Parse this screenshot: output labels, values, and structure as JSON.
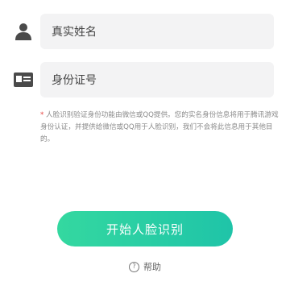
{
  "form": {
    "name_field": {
      "placeholder": "真实姓名",
      "icon": "user-icon"
    },
    "id_field": {
      "placeholder": "身份证号",
      "icon": "id-card-icon"
    }
  },
  "notice": {
    "marker": "*",
    "text": "人脸识别验证身份功能由微信或QQ提供。您的实名身份信息将用于腾讯游戏身份认证，并提供给微信或QQ用于人脸识别，我们不会将此信息用于其他目的。"
  },
  "actions": {
    "start_label": "开始人脸识别",
    "help_label": "帮助",
    "help_icon": "question-circle-icon"
  },
  "colors": {
    "button_gradient_start": "#34d8a0",
    "button_gradient_end": "#1fc4a8",
    "notice_marker": "#e64340",
    "field_background": "#f3f3f4"
  }
}
